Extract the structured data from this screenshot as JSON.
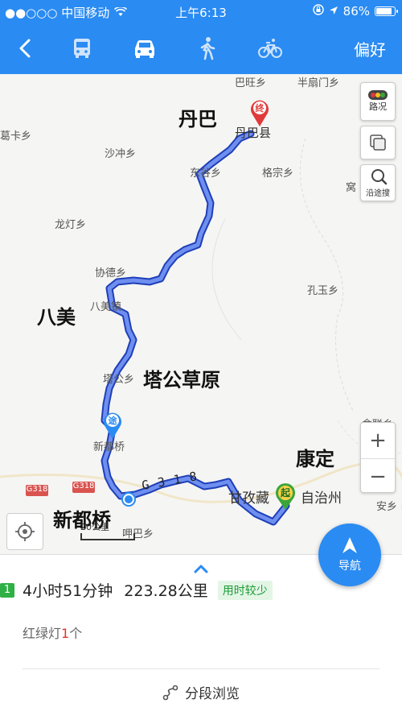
{
  "status_bar": {
    "carrier": "●●○○○ 中国移动",
    "time": "上午6:13",
    "battery": "86%",
    "battery_level": 0.86
  },
  "nav_bar": {
    "preferences": "偏好",
    "modes": [
      "bus-icon",
      "car-icon",
      "walk-icon",
      "bicycle-icon"
    ],
    "selected_mode": "car"
  },
  "map": {
    "places": {
      "bawang": "巴旺乡",
      "banshanmen": "半扇门乡",
      "danba_big": "丹巴",
      "danba_county": "丹巴县",
      "geka": "葛卡乡",
      "shachong": "沙冲乡",
      "dongu": "东谷乡",
      "gezong": "格宗乡",
      "wo": "窝",
      "longdeng": "龙灯乡",
      "xiede": "协德乡",
      "kongyu": "孔玉乡",
      "bamei_big": "八美",
      "bamei_town": "八美镇",
      "tagong_big": "塔公草原",
      "tagong": "塔公乡",
      "xinduqiao_small": "新都桥",
      "kangding_big": "康定",
      "sheliang": "舍联乡",
      "g318_a": "G318",
      "g318_b": "G318",
      "xinduqiao_big": "新都桥",
      "ganzi": "甘孜藏",
      "zizhizhou": "自治州",
      "hubaxiang": "呷巴乡",
      "anxiang": "安乡",
      "g318_road": "G 3 1 8"
    },
    "markers": {
      "end": "终",
      "via": "途",
      "start": "起"
    },
    "scale": "20公里",
    "buttons": {
      "traffic": "路况",
      "search_along": "沿途搜",
      "zoom_in": "+",
      "zoom_out": "−"
    },
    "navigate": "导航",
    "colors": {
      "route": "#4a6cd4",
      "accent": "#2a8bf2",
      "end_marker": "#e03a3a",
      "start_marker": "#3aa53a"
    }
  },
  "route": {
    "number": "1",
    "duration": "4小时51分钟",
    "distance": "223.28公里",
    "tag": "用时较少",
    "traffic_lights_label": "红绿灯",
    "traffic_lights_count": "1",
    "traffic_lights_unit": "个",
    "segments_label": "分段浏览"
  }
}
